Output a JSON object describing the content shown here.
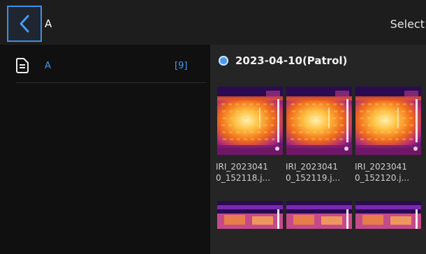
{
  "header": {
    "title": "A",
    "select_label": "Select",
    "back_icon": "chevron-left-icon"
  },
  "folders": [
    {
      "name": "A",
      "count": "[9]",
      "icon": "document-icon"
    }
  ],
  "group": {
    "title": "2023-04-10(Patrol)",
    "selected": true
  },
  "images": [
    {
      "name_line1": "IRI_2023041",
      "name_line2": "0_152118.j..."
    },
    {
      "name_line1": "IRI_2023041",
      "name_line2": "0_152119.j..."
    },
    {
      "name_line1": "IRI_2023041",
      "name_line2": "0_152120.j..."
    }
  ],
  "colors": {
    "accent": "#4a9af0",
    "header_bg": "#1d1d1d",
    "panel_bg": "#252525"
  }
}
